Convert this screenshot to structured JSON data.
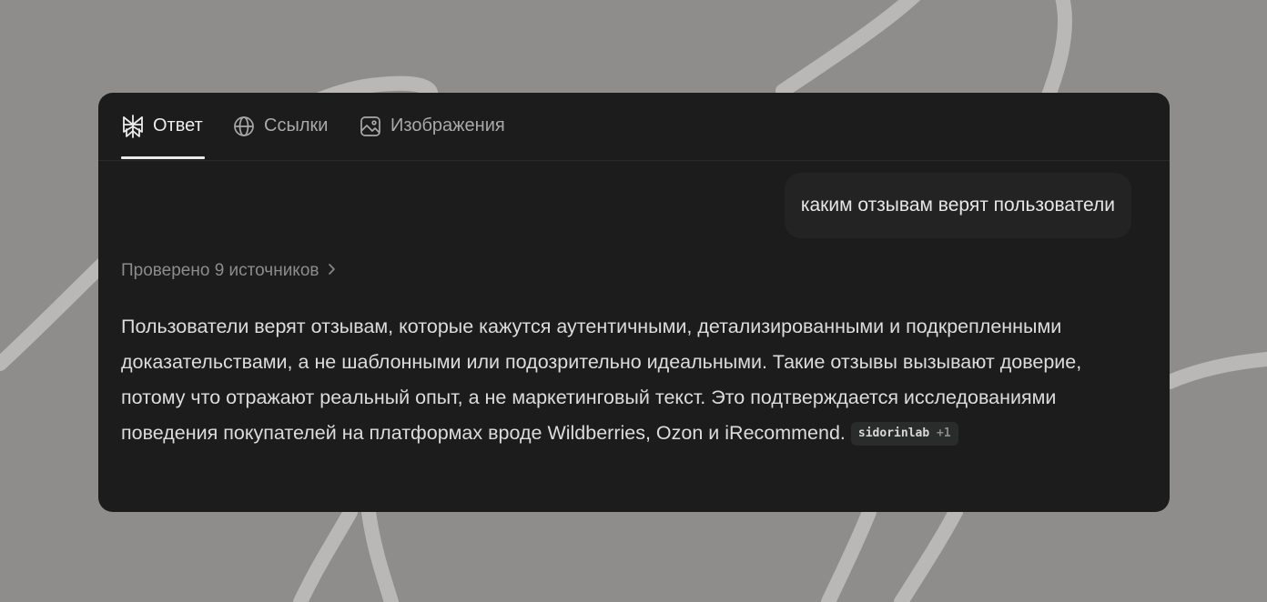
{
  "tabs": [
    {
      "label": "Ответ",
      "icon": "perplexity-logo-icon",
      "active": true
    },
    {
      "label": "Ссылки",
      "icon": "globe-icon",
      "active": false
    },
    {
      "label": "Изображения",
      "icon": "image-icon",
      "active": false
    }
  ],
  "query": "каким отзывам верят пользователи",
  "sources": {
    "label": "Проверено 9 источников",
    "icon": "chevron-right-icon"
  },
  "answer": {
    "text": "Пользователи верят отзывам, которые кажутся аутентичными, детализированными и подкрепленными доказательствами, а не шаблонными или подозрительно идеальными. Такие отзывы вызывают доверие, потому что отражают реальный опыт, а не маркетинговый текст. Это подтверждается исследованиями поведения покупателей на платформах вроде Wildberries, Ozon и iRecommend.",
    "citation": {
      "source": "sidorinlab",
      "more": "+1"
    }
  },
  "colors": {
    "background": "#8e8d8b",
    "card": "#1c1c1c",
    "bubble": "#232323",
    "text": "#dcdcdc",
    "muted": "#8c8c8c"
  }
}
